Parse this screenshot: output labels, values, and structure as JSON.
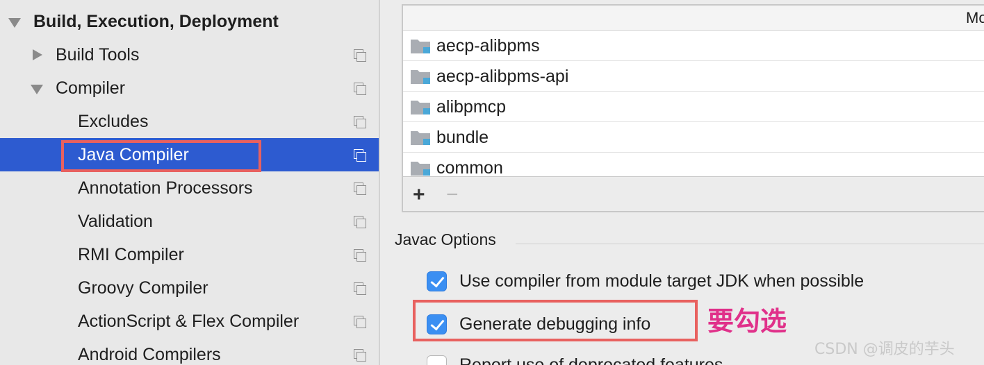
{
  "sidebar": {
    "items": [
      {
        "label": "Build, Execution, Deployment"
      },
      {
        "label": "Build Tools"
      },
      {
        "label": "Compiler"
      },
      {
        "label": "Excludes"
      },
      {
        "label": "Java Compiler"
      },
      {
        "label": "Annotation Processors"
      },
      {
        "label": "Validation"
      },
      {
        "label": "RMI Compiler"
      },
      {
        "label": "Groovy Compiler"
      },
      {
        "label": "ActionScript & Flex Compiler"
      },
      {
        "label": "Android Compilers"
      }
    ],
    "selected_item": "Java Compiler"
  },
  "modules": {
    "column_header": "Mo",
    "rows": [
      {
        "name": "aecp-alibpms"
      },
      {
        "name": "aecp-alibpms-api"
      },
      {
        "name": "alibpmcp"
      },
      {
        "name": "bundle"
      },
      {
        "name": "common"
      }
    ],
    "add_label": "+",
    "remove_label": "−"
  },
  "javac_options": {
    "title": "Javac Options",
    "options": [
      {
        "label": "Use compiler from module target JDK when possible",
        "checked": true
      },
      {
        "label": "Generate debugging info",
        "checked": true
      },
      {
        "label": "Report use of deprecated features",
        "checked": false
      }
    ]
  },
  "annotation_text": "要勾选",
  "watermark": "CSDN @调皮的芋头",
  "colors": {
    "selection": "#2d5bd0",
    "checkbox_checked": "#3b8ff2",
    "highlight_box": "#e8615f",
    "annotation": "#e0318a"
  }
}
